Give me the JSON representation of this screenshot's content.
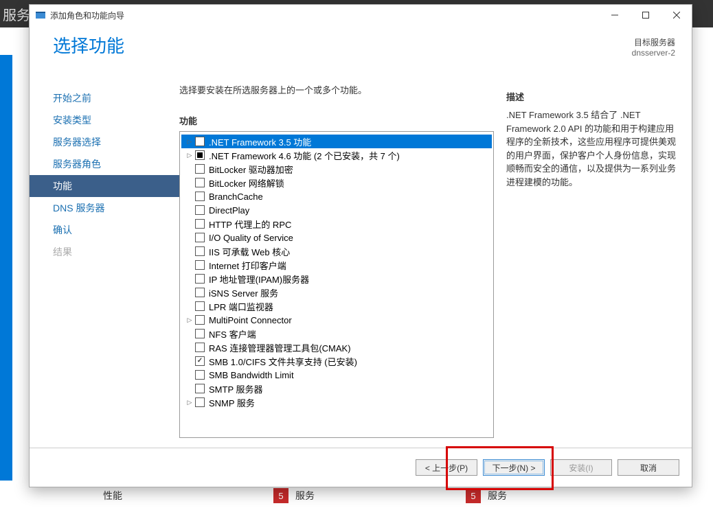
{
  "bg_title": "服务器管理器",
  "window": {
    "title": "添加角色和功能向导"
  },
  "header": {
    "title": "选择功能",
    "target_label": "目标服务器",
    "target_name": "dnsserver-2"
  },
  "steps": [
    {
      "label": "开始之前",
      "state": "normal"
    },
    {
      "label": "安装类型",
      "state": "normal"
    },
    {
      "label": "服务器选择",
      "state": "normal"
    },
    {
      "label": "服务器角色",
      "state": "normal"
    },
    {
      "label": "功能",
      "state": "active"
    },
    {
      "label": "DNS 服务器",
      "state": "normal"
    },
    {
      "label": "确认",
      "state": "normal"
    },
    {
      "label": "结果",
      "state": "disabled"
    }
  ],
  "instruction": "选择要安装在所选服务器上的一个或多个功能。",
  "features_label": "功能",
  "description_label": "描述",
  "description_text": ".NET Framework 3.5 结合了 .NET Framework 2.0 API 的功能和用于构建应用程序的全新技术，这些应用程序可提供美观的用户界面，保护客户个人身份信息，实现顺畅而安全的通信，以及提供为一系列业务进程建模的功能。",
  "features": [
    {
      "label": ".NET Framework 3.5 功能",
      "expandable": true,
      "check": "none",
      "selected": true
    },
    {
      "label": ".NET Framework 4.6 功能 (2 个已安装，共 7 个)",
      "expandable": true,
      "check": "partial"
    },
    {
      "label": "BitLocker 驱动器加密",
      "expandable": false,
      "check": "none"
    },
    {
      "label": "BitLocker 网络解锁",
      "expandable": false,
      "check": "none"
    },
    {
      "label": "BranchCache",
      "expandable": false,
      "check": "none"
    },
    {
      "label": "DirectPlay",
      "expandable": false,
      "check": "none"
    },
    {
      "label": "HTTP 代理上的 RPC",
      "expandable": false,
      "check": "none"
    },
    {
      "label": "I/O Quality of Service",
      "expandable": false,
      "check": "none"
    },
    {
      "label": "IIS 可承载 Web 核心",
      "expandable": false,
      "check": "none"
    },
    {
      "label": "Internet 打印客户端",
      "expandable": false,
      "check": "none"
    },
    {
      "label": "IP 地址管理(IPAM)服务器",
      "expandable": false,
      "check": "none"
    },
    {
      "label": "iSNS Server 服务",
      "expandable": false,
      "check": "none"
    },
    {
      "label": "LPR 端口监视器",
      "expandable": false,
      "check": "none"
    },
    {
      "label": "MultiPoint Connector",
      "expandable": true,
      "check": "none"
    },
    {
      "label": "NFS 客户端",
      "expandable": false,
      "check": "none"
    },
    {
      "label": "RAS 连接管理器管理工具包(CMAK)",
      "expandable": false,
      "check": "none"
    },
    {
      "label": "SMB 1.0/CIFS 文件共享支持 (已安装)",
      "expandable": false,
      "check": "checked"
    },
    {
      "label": "SMB Bandwidth Limit",
      "expandable": false,
      "check": "none"
    },
    {
      "label": "SMTP 服务器",
      "expandable": false,
      "check": "none"
    },
    {
      "label": "SNMP 服务",
      "expandable": true,
      "check": "none"
    }
  ],
  "buttons": {
    "prev": "< 上一步(P)",
    "next": "下一步(N) >",
    "install": "安装(I)",
    "cancel": "取消"
  },
  "bottom": {
    "perf": "性能",
    "badge1": "5",
    "svc1": "服务",
    "badge2": "5",
    "svc2": "服务"
  }
}
